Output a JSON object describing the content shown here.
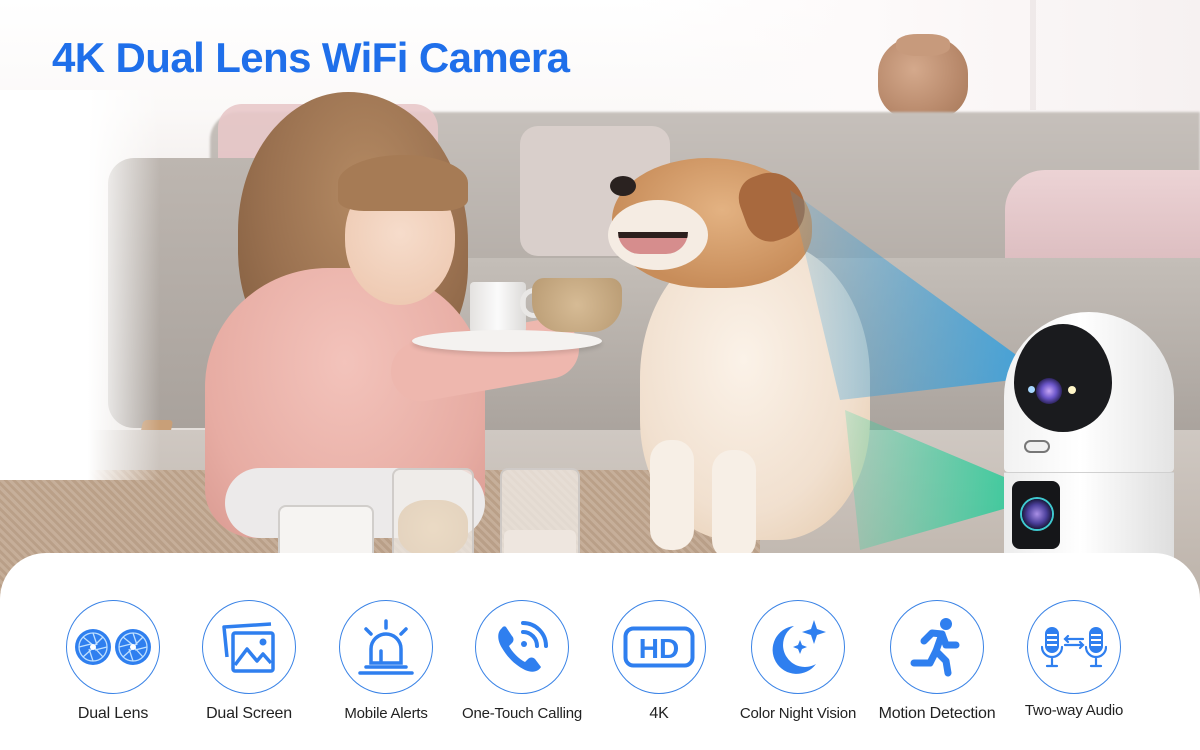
{
  "headline": "4K Dual Lens WiFi Camera",
  "colors": {
    "brand_blue": "#1f6fea",
    "icon_blue": "#2f7fef",
    "ring_blue": "#3a83e6",
    "beam_top": "#2f9fe0",
    "beam_bottom": "#27d7a0",
    "label_text": "#222222"
  },
  "scene": {
    "description": "Girl holding a plate with cup and bowl, feeding a dog on a rug in front of a grey sofa; dual-lens camera on the right projecting blue (top lens) and green (bottom lens) view cones"
  },
  "features": [
    {
      "icon": "dual-lens-icon",
      "label": "Dual Lens"
    },
    {
      "icon": "dual-screen-icon",
      "label": "Dual Screen"
    },
    {
      "icon": "alarm-siren-icon",
      "label": "Mobile Alerts"
    },
    {
      "icon": "phone-call-icon",
      "label": "One-Touch Calling"
    },
    {
      "icon": "hd-icon",
      "label": "4K",
      "badge": "HD"
    },
    {
      "icon": "moon-stars-icon",
      "label": "Color Night Vision"
    },
    {
      "icon": "running-person-icon",
      "label": "Motion Detection"
    },
    {
      "icon": "two-way-microphone-icon",
      "label": "Two-way Audio"
    }
  ]
}
